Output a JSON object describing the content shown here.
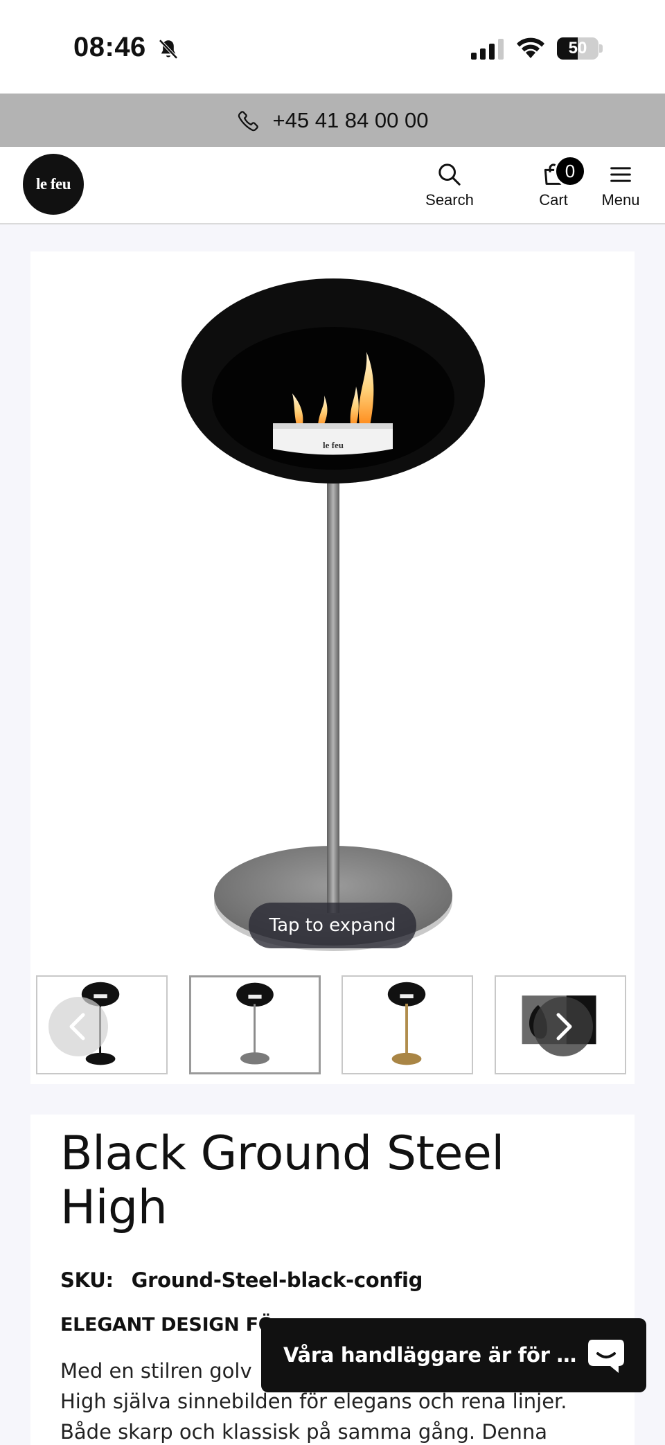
{
  "status_bar": {
    "time": "08:46",
    "battery": "50",
    "battery_level": 0.5
  },
  "top_bar": {
    "phone": "+45 41 84 00 00"
  },
  "header": {
    "logo_text": "le feu",
    "search_label": "Search",
    "cart_label": "Cart",
    "cart_count": "0",
    "menu_label": "Menu"
  },
  "gallery": {
    "expand_label": "Tap to expand",
    "product_brand_mark": "le feu",
    "thumbnails": [
      {
        "color": "#111111",
        "label": "black stand"
      },
      {
        "color": "#7a7a7a",
        "label": "steel stand"
      },
      {
        "color": "#a98545",
        "label": "brass stand"
      },
      {
        "color": "#111111",
        "label": "partial"
      }
    ]
  },
  "product": {
    "title": "Black Ground Steel High",
    "sku_label": "SKU:",
    "sku_value": "Ground-Steel-black-config",
    "section_heading": "ELEGANT DESIGN FÖ",
    "description_lines": [
      "Med en stilren golv",
      "High själva sinnebilden för elegans och rena linjer.",
      "Både skarp och klassisk på samma gång. Denna"
    ]
  },
  "chat": {
    "text": "Våra handläggare är för n..."
  },
  "colors": {
    "phone_bar": "#b3b3b3",
    "page_bg": "#f6f6fb",
    "chat_bg": "#111111"
  }
}
